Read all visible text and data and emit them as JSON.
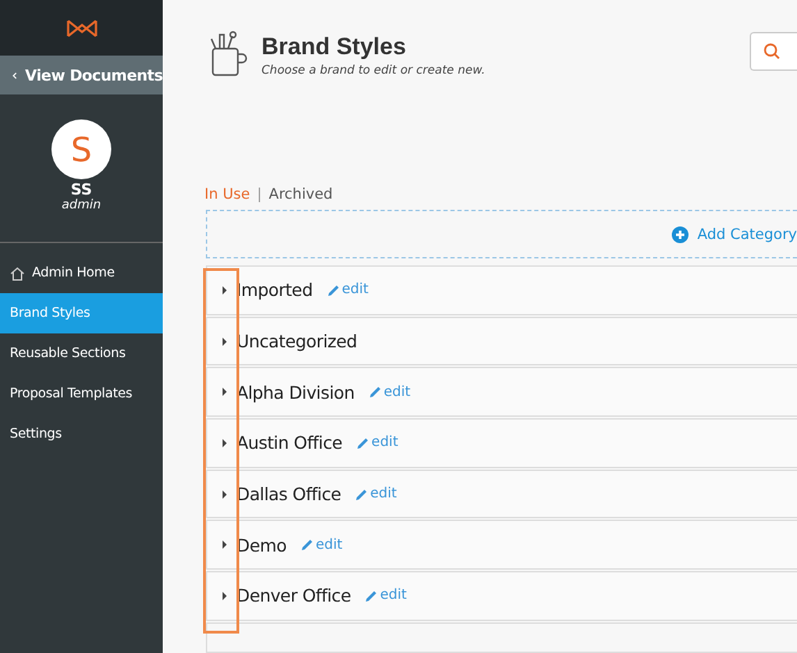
{
  "sidebar": {
    "back_link": "View Documents",
    "user": {
      "initial": "S",
      "name": "SS",
      "role": "admin"
    },
    "items": [
      {
        "label": "Admin Home",
        "kind": "home",
        "selected": false
      },
      {
        "label": "Brand Styles",
        "kind": "plain",
        "selected": true
      },
      {
        "label": "Reusable Sections",
        "kind": "plain",
        "selected": false
      },
      {
        "label": "Proposal Templates",
        "kind": "plain",
        "selected": false
      },
      {
        "label": "Settings",
        "kind": "plain",
        "selected": false
      }
    ]
  },
  "header": {
    "title": "Brand Styles",
    "subtitle": "Choose a brand to edit or create new."
  },
  "tabs": [
    {
      "label": "In Use",
      "selected": true
    },
    {
      "label": "Archived",
      "selected": false
    }
  ],
  "tab_separator": "|",
  "add_button": "Add Category",
  "categories": [
    {
      "name": "Imported",
      "edit": "edit",
      "expanded": false
    },
    {
      "name": "Uncategorized",
      "expanded": false
    },
    {
      "name": "Alpha Division",
      "edit": "edit",
      "expanded": false
    },
    {
      "name": "Austin Office",
      "edit": "edit",
      "expanded": false
    },
    {
      "name": "Dallas Office",
      "edit": "edit",
      "expanded": false
    },
    {
      "name": "Demo",
      "edit": "edit",
      "expanded": false
    },
    {
      "name": "Denver Office",
      "edit": "edit",
      "expanded": false
    }
  ]
}
